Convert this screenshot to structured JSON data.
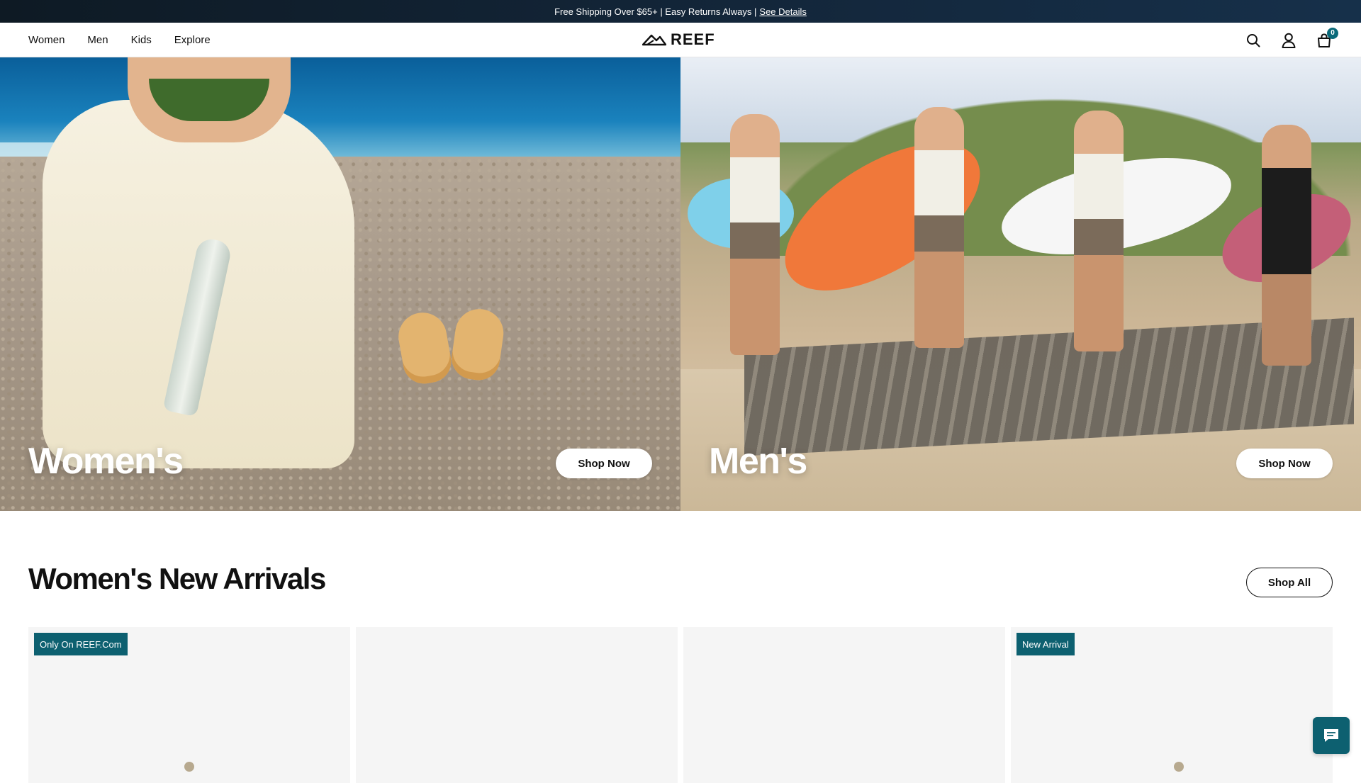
{
  "announcement": {
    "text": "Free Shipping Over $65+ | Easy Returns Always |",
    "link": "See Details"
  },
  "nav": {
    "items": [
      "Women",
      "Men",
      "Kids",
      "Explore"
    ]
  },
  "logo": {
    "text": "REEF"
  },
  "cart": {
    "count": "0"
  },
  "icons": {
    "search": "search-icon",
    "account": "user-icon",
    "cart": "bag-icon",
    "chat": "chat-icon"
  },
  "hero": {
    "women": {
      "title": "Women's",
      "cta": "Shop Now"
    },
    "men": {
      "title": "Men's",
      "cta": "Shop Now"
    }
  },
  "arrivals": {
    "title": "Women's New Arrivals",
    "cta": "Shop All",
    "cards": [
      {
        "badge": "Only On REEF.Com"
      },
      {
        "badge": ""
      },
      {
        "badge": ""
      },
      {
        "badge": "New Arrival"
      }
    ]
  },
  "colors": {
    "brand_teal": "#0d6070",
    "announcement_bg": "#13263a",
    "text": "#111111"
  }
}
